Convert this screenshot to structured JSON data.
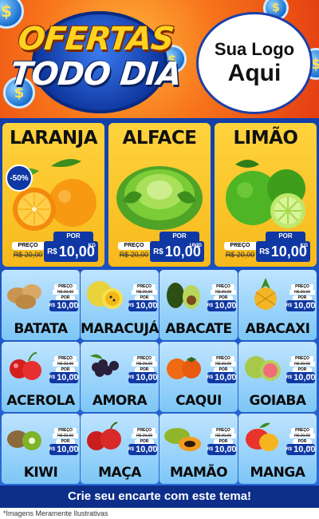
{
  "header": {
    "title_line1": "OFERTAS",
    "title_line2": "TODO DIA",
    "logo_line1": "Sua Logo",
    "logo_line2": "Aqui"
  },
  "price_labels": {
    "preco": "PREÇO",
    "por": "POR",
    "currency": "R$"
  },
  "featured": [
    {
      "name": "LARANJA",
      "badge": "-50%",
      "old_price": "R$ 20,00",
      "price": "10,00",
      "unit": "KG",
      "icon": "orange-icon"
    },
    {
      "name": "ALFACE",
      "old_price": "R$ 20,00",
      "price": "10,00",
      "unit": "UNID",
      "icon": "lettuce-icon"
    },
    {
      "name": "LIMÃO",
      "old_price": "R$ 20,00",
      "price": "10,00",
      "unit": "KG",
      "icon": "lime-icon"
    }
  ],
  "products": [
    {
      "name": "BATATA",
      "old_price": "R$ 20,00",
      "price": "10,00",
      "unit": "KG",
      "icon": "potato-icon"
    },
    {
      "name": "MARACUJÁ",
      "old_price": "R$ 20,00",
      "price": "10,00",
      "unit": "KG",
      "icon": "passion-fruit-icon"
    },
    {
      "name": "ABACATE",
      "old_price": "R$ 20,00",
      "price": "10,00",
      "unit": "KG",
      "icon": "avocado-icon"
    },
    {
      "name": "ABACAXI",
      "old_price": "R$ 20,00",
      "price": "10,00",
      "unit": "KG",
      "icon": "pineapple-icon"
    },
    {
      "name": "ACEROLA",
      "old_price": "R$ 20,00",
      "price": "10,00",
      "unit": "KG",
      "icon": "acerola-icon"
    },
    {
      "name": "AMORA",
      "old_price": "R$ 20,00",
      "price": "10,00",
      "unit": "KG",
      "icon": "blackberry-icon"
    },
    {
      "name": "CAQUI",
      "old_price": "R$ 20,00",
      "price": "10,00",
      "unit": "KG",
      "icon": "persimmon-icon"
    },
    {
      "name": "GOIABA",
      "old_price": "R$ 20,00",
      "price": "10,00",
      "unit": "KG",
      "icon": "guava-icon"
    },
    {
      "name": "KIWI",
      "old_price": "R$ 20,00",
      "price": "10,00",
      "unit": "KG",
      "icon": "kiwi-icon"
    },
    {
      "name": "MAÇA",
      "old_price": "R$ 20,00",
      "price": "10,00",
      "unit": "KG",
      "icon": "apple-icon"
    },
    {
      "name": "MAMÃO",
      "old_price": "R$ 20,00",
      "price": "10,00",
      "unit": "KG",
      "icon": "papaya-icon"
    },
    {
      "name": "MANGA",
      "old_price": "R$ 20,00",
      "price": "10,00",
      "unit": "KG",
      "icon": "mango-icon"
    }
  ],
  "footer": {
    "cta": "Crie seu encarte com este tema!",
    "disclaimer": "*Imagens Meramente Ilustrativas"
  },
  "colors": {
    "header_orange": "#f7731a",
    "brand_blue": "#1038a4",
    "card_yellow": "#ffd33d",
    "card_lightblue": "#9fd4fb"
  }
}
